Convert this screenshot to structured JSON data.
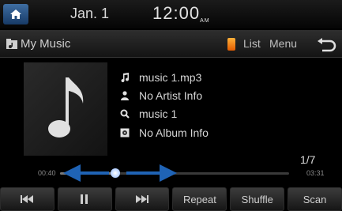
{
  "status": {
    "date": "Jan. 1",
    "time": "12:00",
    "time_suffix": "AM"
  },
  "header": {
    "title": "My Music",
    "list_label": "List",
    "menu_label": "Menu"
  },
  "track": {
    "file": "music 1.mp3",
    "artist": "No Artist Info",
    "title": "music 1",
    "album": "No Album Info",
    "count": "1/7"
  },
  "progress": {
    "elapsed": "00:40",
    "total": "03:31",
    "fraction": 0.24
  },
  "controls": {
    "repeat_label": "Repeat",
    "shuffle_label": "Shuffle",
    "scan_label": "Scan"
  },
  "colors": {
    "accent": "#2a6fd6",
    "arrow": "#1f63b5",
    "usb": "#ff8a00"
  },
  "icons": [
    "home-icon",
    "music-folder-icon",
    "usb-icon",
    "back-icon",
    "music-note-icon",
    "person-icon",
    "search-icon",
    "album-icon",
    "prev-track-icon",
    "pause-icon",
    "next-track-icon"
  ]
}
